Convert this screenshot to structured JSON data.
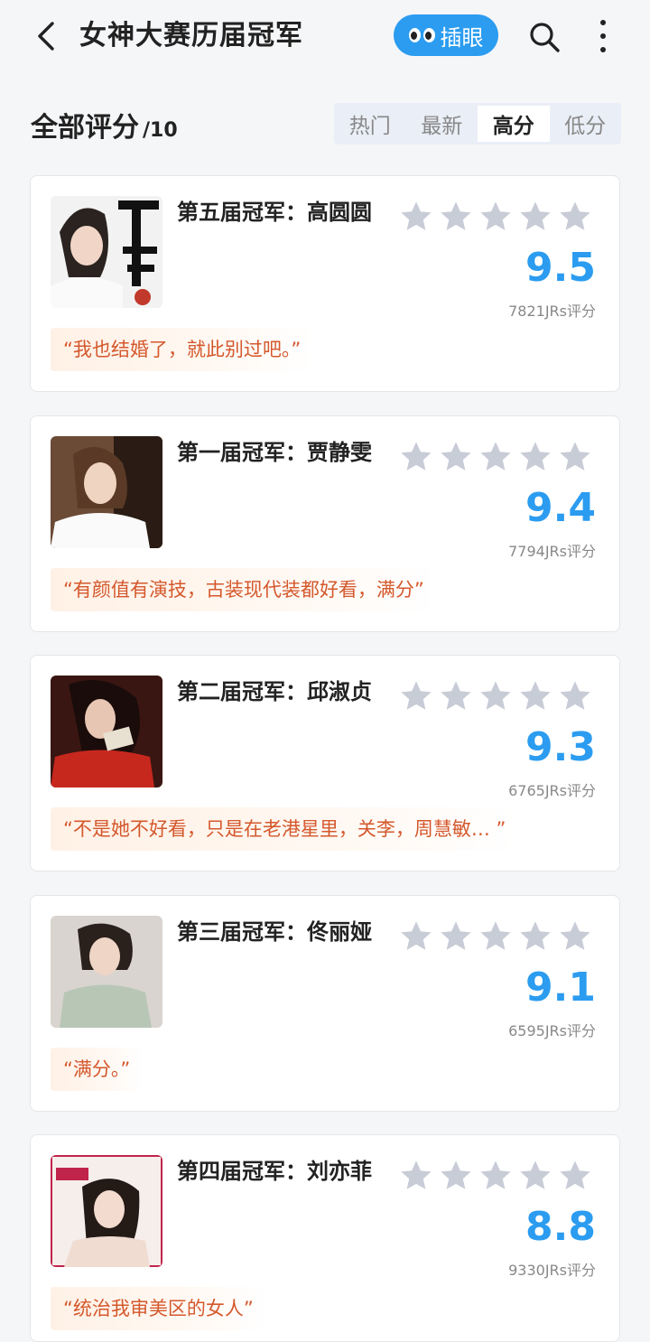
{
  "header": {
    "title": "女神大赛历届冠军",
    "peek_label": "插眼"
  },
  "section": {
    "title": "全部评分",
    "subtitle": "/10"
  },
  "sort_tabs": [
    {
      "label": "热门",
      "active": false
    },
    {
      "label": "最新",
      "active": false
    },
    {
      "label": "高分",
      "active": true
    },
    {
      "label": "低分",
      "active": false
    }
  ],
  "items": [
    {
      "title": "第五届冠军：高圆圆",
      "score": "9.5",
      "count": "7821JRs评分",
      "quote": "“我也结婚了，就此别过吧。”"
    },
    {
      "title": "第一届冠军：贾静雯",
      "score": "9.4",
      "count": "7794JRs评分",
      "quote": "“有颜值有演技，古装现代装都好看，满分”"
    },
    {
      "title": "第二届冠军：邱淑贞",
      "score": "9.3",
      "count": "6765JRs评分",
      "quote": "“不是她不好看，只是在老港星里，关李，周慧敏…  ”"
    },
    {
      "title": "第三届冠军：佟丽娅",
      "score": "9.1",
      "count": "6595JRs评分",
      "quote": "“满分。”"
    },
    {
      "title": "第四届冠军：刘亦菲",
      "score": "8.8",
      "count": "9330JRs评分",
      "quote": "“统治我审美区的女人”"
    }
  ],
  "colors": {
    "accent": "#2b9cf0",
    "quote_text": "#d4582c",
    "star": "#c8ccd6"
  }
}
